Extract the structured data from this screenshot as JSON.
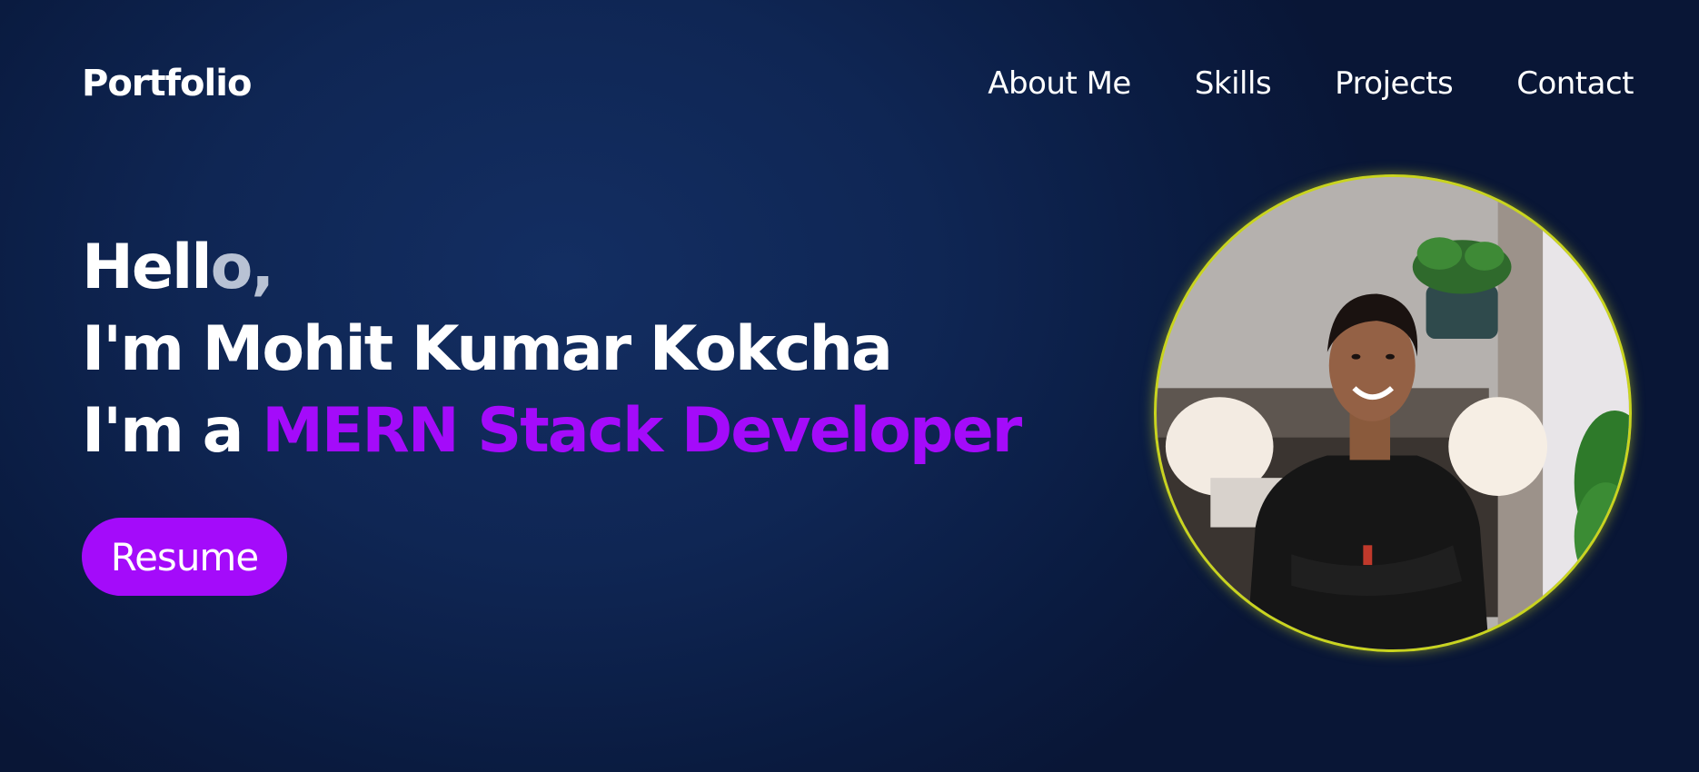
{
  "nav": {
    "logo": "Portfolio",
    "links": [
      {
        "label": "About Me"
      },
      {
        "label": "Skills"
      },
      {
        "label": "Projects"
      },
      {
        "label": "Contact"
      }
    ]
  },
  "hero": {
    "greeting_main": "Hell",
    "greeting_fade": "o,",
    "name_line": "I'm Mohit Kumar Kokcha",
    "role_prefix": "I'm a ",
    "role": "MERN Stack Developer",
    "resume_label": "Resume"
  },
  "photo": {
    "alt": "profile-photo"
  },
  "colors": {
    "accent": "#a40bfa",
    "frame_border": "#c9d41f",
    "background": "#0f2654"
  }
}
